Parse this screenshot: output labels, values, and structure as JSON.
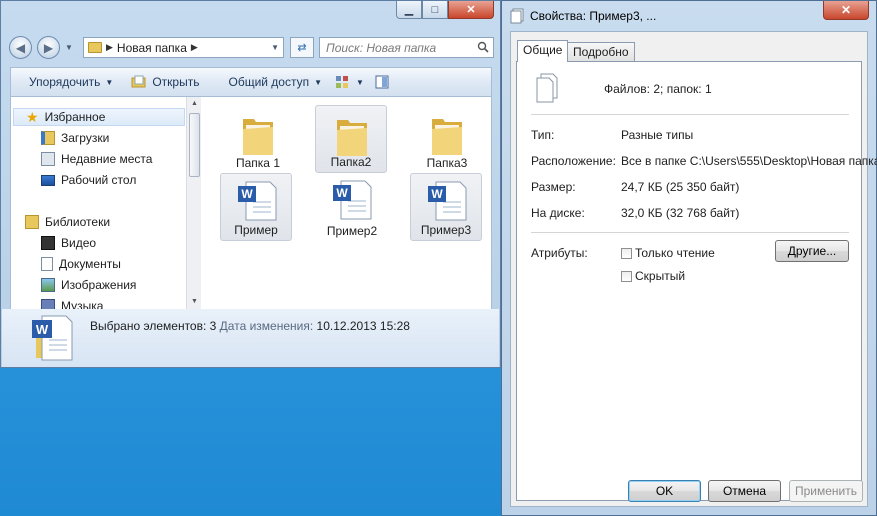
{
  "explorer": {
    "address": {
      "path_label": "Новая папка"
    },
    "search": {
      "placeholder": "Поиск: Новая папка"
    },
    "toolbar": {
      "organize_label": "Упорядочить",
      "open_label": "Открыть",
      "share_label": "Общий доступ"
    },
    "nav": {
      "favorites_label": "Избранное",
      "favorites": [
        "Загрузки",
        "Недавние места",
        "Рабочий стол"
      ],
      "libraries_label": "Библиотеки",
      "libraries": [
        "Видео",
        "Документы",
        "Изображения",
        "Музыка"
      ]
    },
    "files": [
      {
        "name": "Папка 1",
        "kind": "folder",
        "selected": false
      },
      {
        "name": "Папка2",
        "kind": "folder",
        "selected": true
      },
      {
        "name": "Папка3",
        "kind": "folder",
        "selected": false
      },
      {
        "name": "Пример",
        "kind": "word-doc",
        "selected": true
      },
      {
        "name": "Пример2",
        "kind": "word-doc",
        "selected": false
      },
      {
        "name": "Пример3",
        "kind": "word-doc",
        "selected": true
      }
    ],
    "details": {
      "selected_text": "Выбрано элементов: 3",
      "modified_label": "Дата изменения:",
      "modified_value": "10.12.2013 15:28"
    }
  },
  "dialog": {
    "title": "Свойства: Пример3, ...",
    "tabs": [
      "Общие",
      "Подробно"
    ],
    "summary": "Файлов: 2; папок: 1",
    "type_label": "Тип:",
    "type_value": "Разные типы",
    "location_label": "Расположение:",
    "location_value": "Все в папке C:\\Users\\555\\Desktop\\Новая папка",
    "size_label": "Размер:",
    "size_value": "24,7 КБ (25 350 байт)",
    "disk_label": "На диске:",
    "disk_value": "32,0 КБ (32 768 байт)",
    "attributes_label": "Атрибуты:",
    "readonly_label": "Только чтение",
    "hidden_label": "Скрытый",
    "other_button": "Другие...",
    "ok_button": "OK",
    "cancel_button": "Отмена",
    "apply_button": "Применить"
  },
  "colors": {
    "desktop": "#2b95dc",
    "window_frame": "#b7cfe6",
    "close_red": "#c9462c",
    "folder_yellow": "#e8c75c",
    "word_blue": "#2a5caa"
  }
}
